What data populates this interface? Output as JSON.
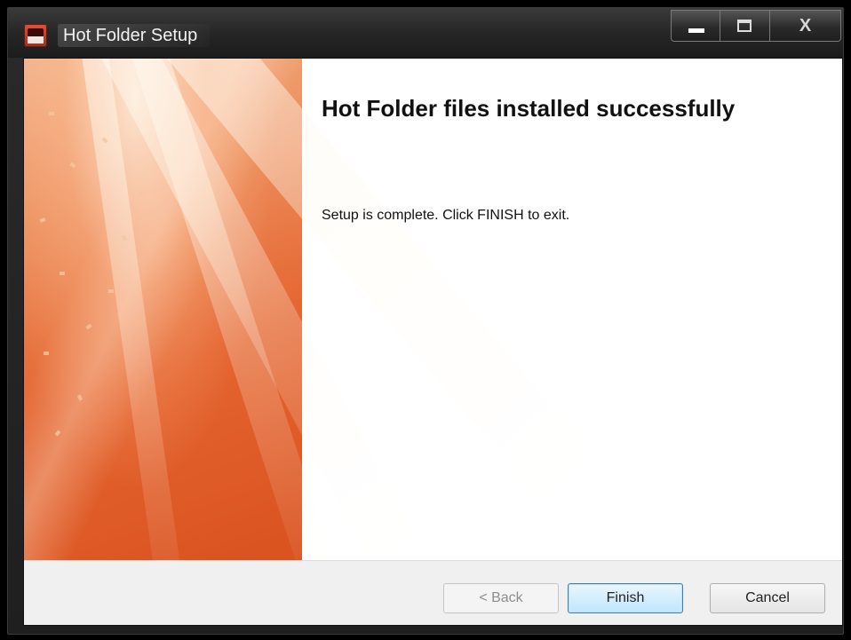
{
  "window": {
    "title": "Hot Folder Setup",
    "caption_buttons": {
      "minimize_icon": "minimize-icon",
      "maximize_icon": "maximize-icon",
      "close_glyph": "X"
    }
  },
  "content": {
    "heading": "Hot Folder files installed successfully",
    "message": "Setup is complete. Click FINISH to exit."
  },
  "footer": {
    "back_label": "< Back",
    "finish_label": "Finish",
    "cancel_label": "Cancel"
  },
  "colors": {
    "banner_orange": "#e4642f",
    "primary_button_border": "#3c7fb1",
    "titlebar": "#262626"
  }
}
